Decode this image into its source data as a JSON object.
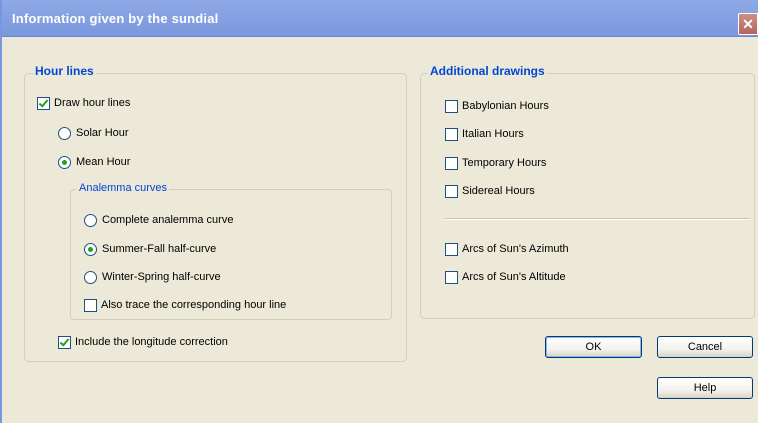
{
  "window": {
    "title": "Information given by the sundial",
    "close_glyph": "✕"
  },
  "hour_lines": {
    "title": "Hour lines",
    "draw_hour_lines": {
      "label": "Draw hour lines",
      "checked": true
    },
    "solar_hour": {
      "label": "Solar Hour",
      "selected": false
    },
    "mean_hour": {
      "label": "Mean Hour",
      "selected": true
    },
    "analemma": {
      "title": "Analemma curves",
      "complete": {
        "label": "Complete analemma curve",
        "selected": false
      },
      "summer_fall": {
        "label": "Summer-Fall half-curve",
        "selected": true
      },
      "winter_spring": {
        "label": "Winter-Spring half-curve",
        "selected": false
      },
      "also_trace": {
        "label": "Also trace the corresponding hour line",
        "checked": false
      }
    },
    "longitude": {
      "label": "Include the longitude correction",
      "checked": true
    }
  },
  "additional": {
    "title": "Additional drawings",
    "babylonian": {
      "label": "Babylonian Hours",
      "checked": false
    },
    "italian": {
      "label": "Italian Hours",
      "checked": false
    },
    "temporary": {
      "label": "Temporary Hours",
      "checked": false
    },
    "sidereal": {
      "label": "Sidereal Hours",
      "checked": false
    },
    "azimuth": {
      "label": "Arcs of Sun's Azimuth",
      "checked": false
    },
    "altitude": {
      "label": "Arcs of Sun's Altitude",
      "checked": false
    }
  },
  "buttons": {
    "ok": "OK",
    "cancel": "Cancel",
    "help": "Help"
  }
}
